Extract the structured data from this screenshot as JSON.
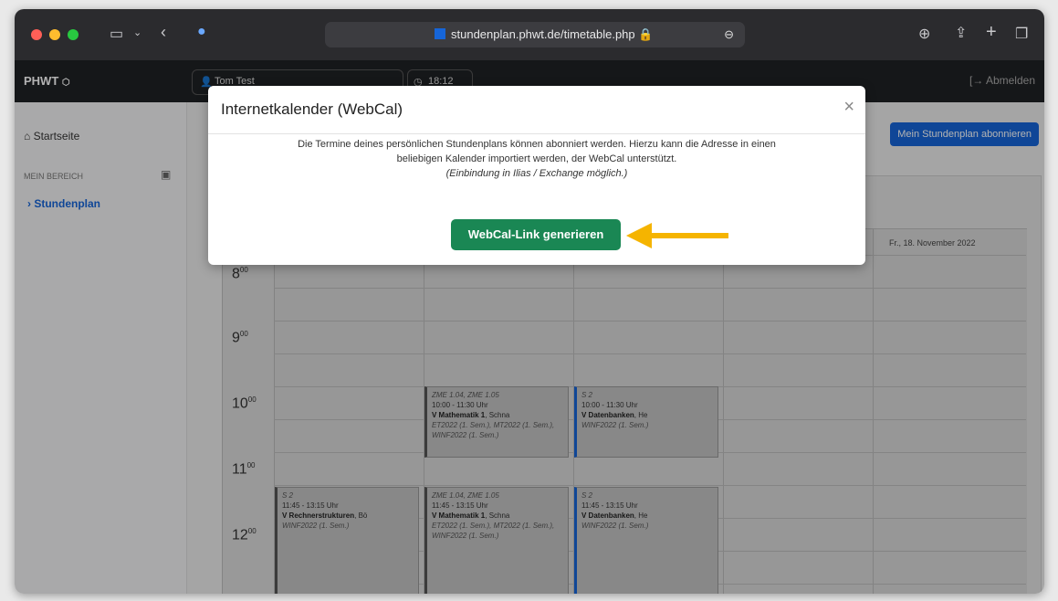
{
  "browser": {
    "url": "stundenplan.phwt.de/timetable.php",
    "traffic_colors": [
      "#ff5f57",
      "#febc2e",
      "#28c840"
    ]
  },
  "navbar": {
    "brand": "PHWT",
    "user": "Tom Test",
    "time": "18:12",
    "logout": "[→ Abmelden"
  },
  "sidebar": {
    "home": "Startseite",
    "section": "MEIN BEREICH",
    "items": [
      {
        "label": "Stundenplan"
      }
    ]
  },
  "main": {
    "subscribe_button": "Mein Stundenplan abonnieren",
    "day_header_friday": "Fr., 18. November 2022",
    "hours": [
      {
        "h": "8",
        "m": "00"
      },
      {
        "h": "9",
        "m": "00"
      },
      {
        "h": "10",
        "m": "00"
      },
      {
        "h": "11",
        "m": "00"
      },
      {
        "h": "12",
        "m": "00"
      }
    ],
    "events": [
      {
        "room": "ZME 1.04, ZME 1.05",
        "time": "10:00 - 11:30 Uhr",
        "title": "V Mathematik 1",
        "lecturer": ", Schna",
        "groups": "ET2022 (1. Sem.), MT2022 (1. Sem.), WINF2022 (1. Sem.)"
      },
      {
        "room": "S 2",
        "time": "10:00 - 11:30 Uhr",
        "title": "V Datenbanken",
        "lecturer": ", He",
        "groups": "WINF2022 (1. Sem.)"
      },
      {
        "room": "S 2",
        "time": "11:45 - 13:15 Uhr",
        "title": "V Rechnerstrukturen",
        "lecturer": ", Bö",
        "groups": "WINF2022 (1. Sem.)"
      },
      {
        "room": "ZME 1.04, ZME 1.05",
        "time": "11:45 - 13:15 Uhr",
        "title": "V Mathematik 1",
        "lecturer": ", Schna",
        "groups": "ET2022 (1. Sem.), MT2022 (1. Sem.), WINF2022 (1. Sem.)"
      },
      {
        "room": "S 2",
        "time": "11:45 - 13:15 Uhr",
        "title": "V Datenbanken",
        "lecturer": ", He",
        "groups": "WINF2022 (1. Sem.)"
      }
    ]
  },
  "modal": {
    "title": "Internetkalender (WebCal)",
    "close": "×",
    "text_line1": "Die Termine deines persönlichen Stundenplans können abonniert werden. Hierzu kann die Adresse in einen",
    "text_line2": "beliebigen Kalender importiert werden, der WebCal unterstützt.",
    "hint": "(Einbindung in Ilias / Exchange möglich.)",
    "button": "WebCal-Link generieren"
  },
  "colors": {
    "primary": "#1665d8",
    "success": "#1a8754",
    "arrow": "#f5b400"
  }
}
